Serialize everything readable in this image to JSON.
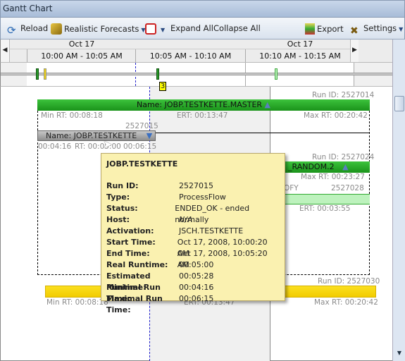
{
  "window": {
    "title": "Gantt Chart"
  },
  "toolbar": {
    "reload": "Reload",
    "forecasts": "Realistic Forecasts",
    "expand": "Expand All",
    "collapse": "Collapse All",
    "export": "Export",
    "settings": "Settings"
  },
  "timeline": {
    "dates": [
      "Oct 17",
      "Oct 17"
    ],
    "ranges": [
      "10:00 AM - 10:05 AM",
      "10:05 AM - 10:10 AM",
      "10:10 AM - 10:15 AM"
    ],
    "badge": "3"
  },
  "jobs": {
    "master": {
      "run_id": "Run ID: 2527014",
      "name": "Name: JOBP.TESTKETTE.MASTER",
      "min": "Min RT: 00:08:18",
      "ert": "ERT: 00:13:47",
      "max": "Max RT: 00:20:42"
    },
    "kette": {
      "run_id": "2527015",
      "name": "Name: JOBP.TESTKETTE",
      "min": "00:04:16",
      "rt": "RT: 00:05:00",
      "max": "00:06:15"
    },
    "random": {
      "run_id": "Run ID: 2527024",
      "name": "_RANDOM.2",
      "max": "Max RT: 00:23:27"
    },
    "ofy": {
      "name": "OFY",
      "run_id": "2527028",
      "ert": "ERT: 00:03:55"
    },
    "yellow": {
      "run_id": "Run ID: 2527030",
      "min": "Min RT: 00:08:18",
      "ert": "ERT: 00:13:47",
      "max": "Max RT: 00:20:42"
    }
  },
  "tooltip": {
    "title": "JOBP.TESTKETTE",
    "rows": [
      {
        "k": "Run ID:",
        "v": "2527015"
      },
      {
        "k": "Type:",
        "v": "ProcessFlow"
      },
      {
        "k": "Status:",
        "v": "ENDED_OK - ended normally"
      },
      {
        "k": "Host:",
        "v": "N/A"
      },
      {
        "k": "Activation:",
        "v": "JSCH.TESTKETTE"
      },
      {
        "k": "Start Time:",
        "v": "Oct 17, 2008, 10:00:20 AM"
      },
      {
        "k": "End Time:",
        "v": "Oct 17, 2008, 10:05:20 AM"
      },
      {
        "k": "Real Runtime:",
        "v": "00:05:00"
      },
      {
        "k": "Estimated Runtime:",
        "v": "00:05:28"
      },
      {
        "k": "Minimal Run Time:",
        "v": "00:04:16"
      },
      {
        "k": "Maximal Run Time:",
        "v": "00:06:15"
      }
    ]
  }
}
